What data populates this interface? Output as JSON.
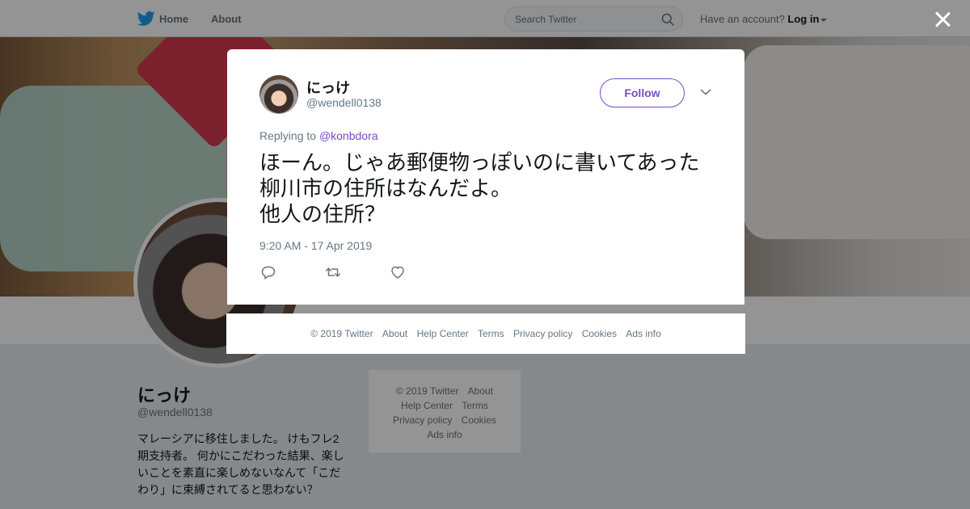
{
  "topbar": {
    "home_label": "Home",
    "about_label": "About",
    "search_placeholder": "Search Twitter",
    "have_account": "Have an account?",
    "login_label": "Log in"
  },
  "profile": {
    "name": "にっけ",
    "handle": "@wendell0138",
    "bio": "マレーシアに移住しました。 けもフレ2期支持者。 何かにこだわった結果、楽しいことを素直に楽しめないなんて「こだわり」に束縛されてると思わない？"
  },
  "side_footer": {
    "copyright": "© 2019 Twitter",
    "about": "About",
    "help": "Help Center",
    "terms": "Terms",
    "privacy": "Privacy policy",
    "cookies": "Cookies",
    "ads": "Ads info"
  },
  "tweet": {
    "name": "にっけ",
    "handle": "@wendell0138",
    "follow_label": "Follow",
    "replying_prefix": "Replying to",
    "replying_to": "@konbdora",
    "text": "ほーん。じゃあ郵便物っぽいのに書いてあった柳川市の住所はなんだよ。\n他人の住所？",
    "timestamp": "9:20 AM - 17 Apr 2019"
  },
  "modal_footer": {
    "copyright": "© 2019 Twitter",
    "about": "About",
    "help": "Help Center",
    "terms": "Terms",
    "privacy": "Privacy policy",
    "cookies": "Cookies",
    "ads": "Ads info"
  },
  "colors": {
    "accent": "#794bc4",
    "brand_bird": "#1da1f2",
    "muted_text": "#657786"
  },
  "icons": [
    "twitter-bird-icon",
    "search-icon",
    "close-icon",
    "chevron-down-icon",
    "reply-icon",
    "retweet-icon",
    "like-icon"
  ]
}
